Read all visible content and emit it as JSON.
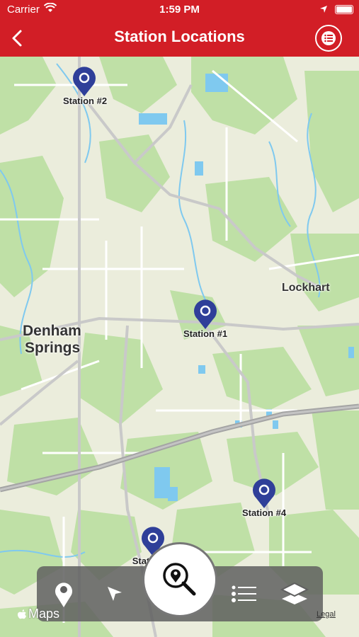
{
  "status_bar": {
    "carrier": "Carrier",
    "time": "1:59 PM"
  },
  "nav": {
    "title": "Station Locations"
  },
  "map": {
    "places": [
      "Denham",
      "Springs",
      "Lockhart"
    ],
    "stations": [
      {
        "label": "Station #2"
      },
      {
        "label": "Station #1"
      },
      {
        "label": "Station #4"
      },
      {
        "label": "Stat"
      }
    ]
  },
  "footer": {
    "maps_label": "Maps",
    "legal": "Legal"
  },
  "colors": {
    "brand_red": "#d21e26",
    "pin_blue": "#2f3f99",
    "water": "#7fc9ef",
    "park": "#bfe0a6"
  },
  "icons": [
    "back-chevron-icon",
    "list-icon",
    "location-pin-icon",
    "navigation-arrow-icon",
    "map-search-icon",
    "list-bullets-icon",
    "layers-icon",
    "apple-logo-icon"
  ]
}
